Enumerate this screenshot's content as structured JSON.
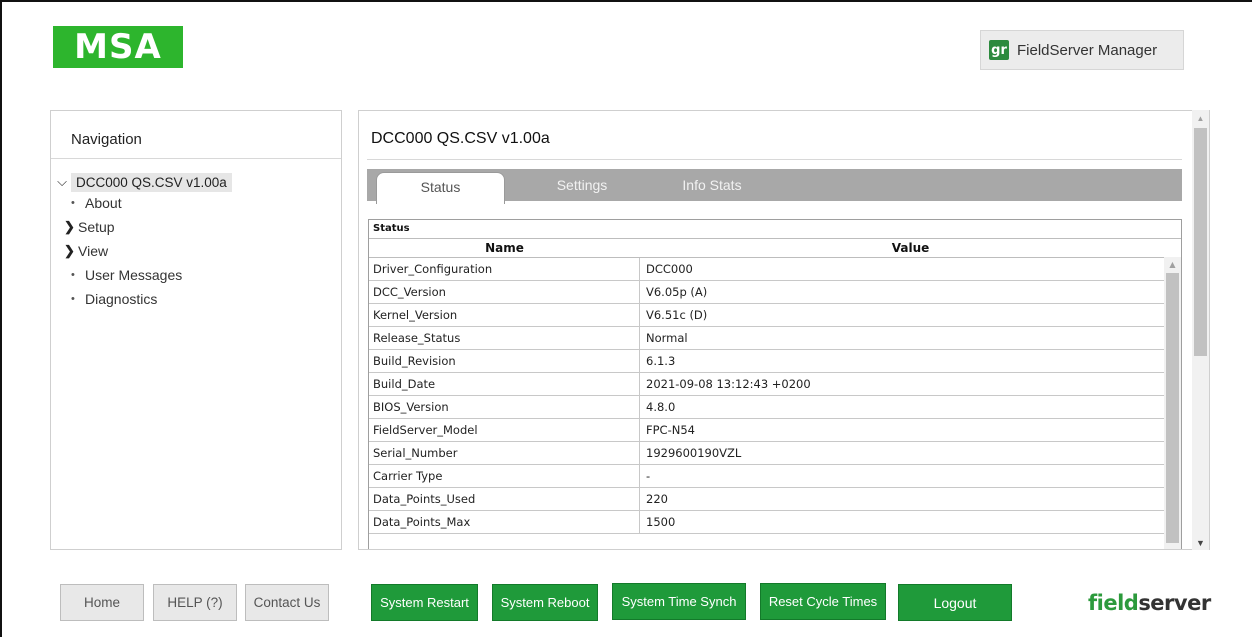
{
  "header": {
    "logo_text": "MSA",
    "manager_button": {
      "icon": "gr",
      "label": "FieldServer Manager"
    }
  },
  "navigation": {
    "title": "Navigation",
    "root": "DCC000 QS.CSV v1.00a",
    "items": [
      {
        "label": "About",
        "type": "leaf"
      },
      {
        "label": "Setup",
        "type": "collapsed"
      },
      {
        "label": "View",
        "type": "collapsed"
      },
      {
        "label": "User Messages",
        "type": "leaf"
      },
      {
        "label": "Diagnostics",
        "type": "leaf"
      }
    ]
  },
  "main": {
    "title": "DCC000 QS.CSV v1.00a",
    "tabs": [
      "Status",
      "Settings",
      "Info Stats"
    ],
    "active_tab": "Status",
    "status": {
      "caption": "Status",
      "columns": [
        "Name",
        "Value"
      ],
      "rows": [
        [
          "Driver_Configuration",
          "DCC000"
        ],
        [
          "DCC_Version",
          "V6.05p (A)"
        ],
        [
          "Kernel_Version",
          "V6.51c (D)"
        ],
        [
          "Release_Status",
          "Normal"
        ],
        [
          "Build_Revision",
          "6.1.3"
        ],
        [
          "Build_Date",
          "2021-09-08 13:12:43 +0200"
        ],
        [
          "BIOS_Version",
          "4.8.0"
        ],
        [
          "FieldServer_Model",
          "FPC-N54"
        ],
        [
          "Serial_Number",
          "1929600190VZL"
        ],
        [
          "Carrier Type",
          "-"
        ],
        [
          "Data_Points_Used",
          "220"
        ],
        [
          "Data_Points_Max",
          "1500"
        ]
      ]
    }
  },
  "footer": {
    "secondary_buttons": [
      "Home",
      "HELP (?)",
      "Contact Us"
    ],
    "action_buttons": [
      "System Restart",
      "System Reboot",
      "System Time Synch",
      "Reset Cycle Times",
      "Logout"
    ],
    "brand": {
      "part1": "field",
      "part2": "server"
    }
  },
  "colors": {
    "brand_green": "#2db52d",
    "action_green": "#1f9a3a",
    "tab_bar": "#a8a8a8"
  }
}
